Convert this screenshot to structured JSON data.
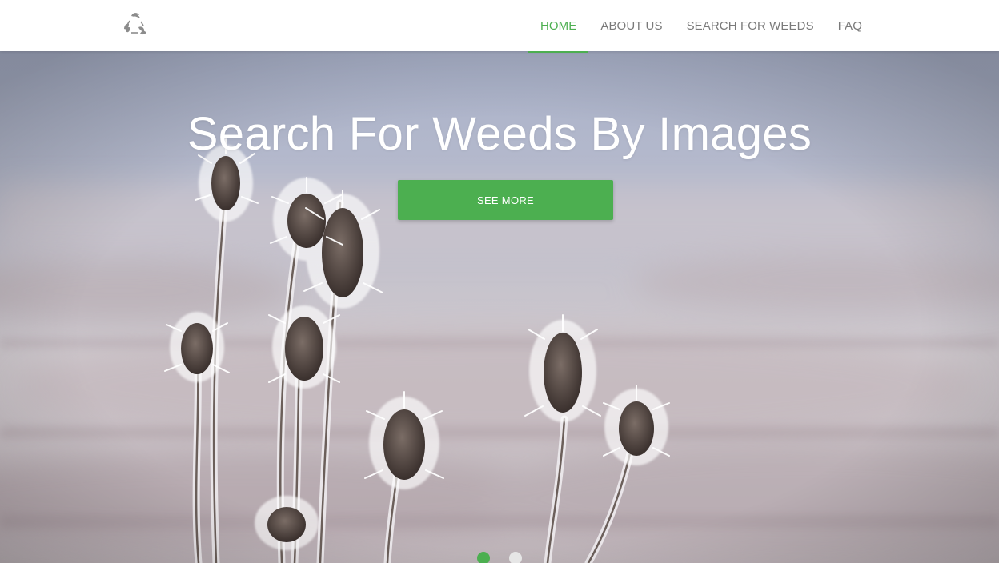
{
  "header": {
    "logo_icon": "recycle-leaves-icon",
    "nav": [
      {
        "label": "HOME",
        "active": true
      },
      {
        "label": "ABOUT US",
        "active": false
      },
      {
        "label": "SEARCH FOR WEEDS",
        "active": false
      },
      {
        "label": "FAQ",
        "active": false
      }
    ]
  },
  "hero": {
    "title": "Search For Weeds By Images",
    "button_label": "SEE MORE",
    "slides_count": 2,
    "active_slide": 1
  },
  "colors": {
    "accent": "#4caf50",
    "nav_text": "#7a7a7a",
    "title_text": "#ffffff"
  }
}
